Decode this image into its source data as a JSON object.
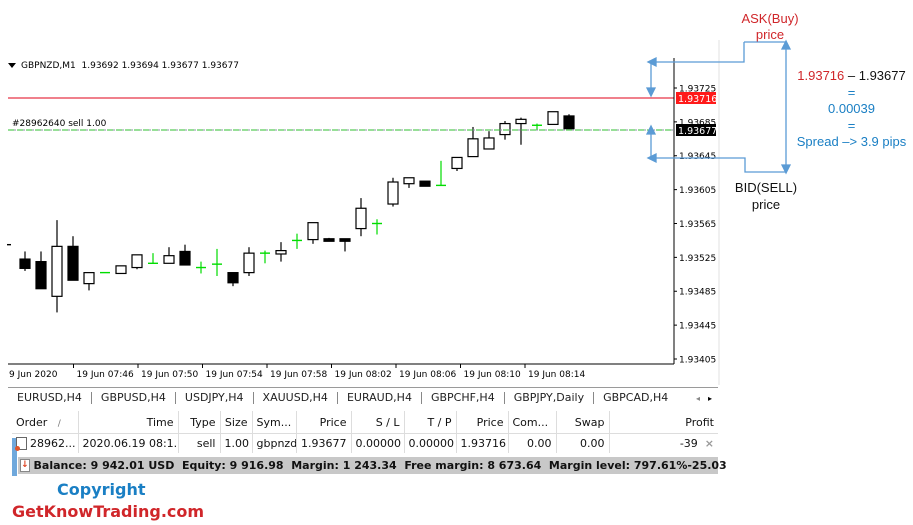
{
  "chart": {
    "header": {
      "symbol": "GBPNZD,M1",
      "ohlc": "1.93692 1.93694 1.93677 1.93677"
    },
    "order_label": "#28962640 sell 1.00",
    "ask_price_label": "1.93716",
    "bid_price_label": "1.93677",
    "colors": {
      "ask_line": "#e0001a",
      "bid_line": "#2fbf2f",
      "ask_badge": "#ff1a1a",
      "bid_badge": "#000000",
      "doji": "#00dd00"
    }
  },
  "chart_data": {
    "type": "candlestick",
    "title": "GBPNZD,M1",
    "ylim": [
      1.93385,
      1.93745
    ],
    "y_ticks": [
      "1.93725",
      "1.93685",
      "1.93645",
      "1.93605",
      "1.93565",
      "1.93525",
      "1.93485",
      "1.93445",
      "1.93405"
    ],
    "x_ticks": [
      "9 Jun 2020",
      "19 Jun 07:46",
      "19 Jun 07:50",
      "19 Jun 07:54",
      "19 Jun 07:58",
      "19 Jun 08:02",
      "19 Jun 08:06",
      "19 Jun 08:10",
      "19 Jun 08:14"
    ],
    "ask": 1.93716,
    "bid": 1.93677,
    "candles": [
      {
        "o": 1.9354,
        "h": 1.9354,
        "l": 1.9354,
        "c": 1.9354
      },
      {
        "o": 1.93523,
        "h": 1.93532,
        "l": 1.93509,
        "c": 1.93512
      },
      {
        "o": 1.9352,
        "h": 1.93532,
        "l": 1.93488,
        "c": 1.93488
      },
      {
        "o": 1.93479,
        "h": 1.93569,
        "l": 1.9346,
        "c": 1.93538
      },
      {
        "o": 1.93538,
        "h": 1.9355,
        "l": 1.93498,
        "c": 1.93498
      },
      {
        "o": 1.93494,
        "h": 1.93494,
        "l": 1.93486,
        "c": 1.93507
      },
      {
        "o": 1.93507,
        "h": 1.93507,
        "l": 1.93507,
        "c": 1.93507
      },
      {
        "o": 1.93506,
        "h": 1.93515,
        "l": 1.93506,
        "c": 1.93515
      },
      {
        "o": 1.93513,
        "h": 1.93528,
        "l": 1.93511,
        "c": 1.93528
      },
      {
        "o": 1.93518,
        "h": 1.9353,
        "l": 1.93518,
        "c": 1.93518
      },
      {
        "o": 1.93518,
        "h": 1.93537,
        "l": 1.93518,
        "c": 1.93527
      },
      {
        "o": 1.93532,
        "h": 1.9354,
        "l": 1.93516,
        "c": 1.93516
      },
      {
        "o": 1.93513,
        "h": 1.9352,
        "l": 1.93506,
        "c": 1.93513
      },
      {
        "o": 1.93517,
        "h": 1.93535,
        "l": 1.93503,
        "c": 1.93517
      },
      {
        "o": 1.93507,
        "h": 1.93507,
        "l": 1.93491,
        "c": 1.93495
      },
      {
        "o": 1.93507,
        "h": 1.93537,
        "l": 1.93503,
        "c": 1.9353
      },
      {
        "o": 1.9353,
        "h": 1.93533,
        "l": 1.93518,
        "c": 1.9353
      },
      {
        "o": 1.93529,
        "h": 1.93543,
        "l": 1.9352,
        "c": 1.93533
      },
      {
        "o": 1.93545,
        "h": 1.93553,
        "l": 1.93535,
        "c": 1.93545
      },
      {
        "o": 1.93546,
        "h": 1.93566,
        "l": 1.93541,
        "c": 1.93566
      },
      {
        "o": 1.93547,
        "h": 1.93548,
        "l": 1.93545,
        "c": 1.93544
      },
      {
        "o": 1.93547,
        "h": 1.93547,
        "l": 1.93532,
        "c": 1.93544
      },
      {
        "o": 1.93559,
        "h": 1.93595,
        "l": 1.9355,
        "c": 1.93583
      },
      {
        "o": 1.93565,
        "h": 1.9357,
        "l": 1.93552,
        "c": 1.93565
      },
      {
        "o": 1.93588,
        "h": 1.93619,
        "l": 1.93585,
        "c": 1.93614
      },
      {
        "o": 1.93612,
        "h": 1.93618,
        "l": 1.93607,
        "c": 1.93619
      },
      {
        "o": 1.93615,
        "h": 1.93615,
        "l": 1.93615,
        "c": 1.93609
      },
      {
        "o": 1.9361,
        "h": 1.93639,
        "l": 1.9361,
        "c": 1.9361
      },
      {
        "o": 1.9363,
        "h": 1.93643,
        "l": 1.93627,
        "c": 1.93643
      },
      {
        "o": 1.93644,
        "h": 1.93679,
        "l": 1.93644,
        "c": 1.93665
      },
      {
        "o": 1.93653,
        "h": 1.93674,
        "l": 1.93653,
        "c": 1.93666
      },
      {
        "o": 1.9367,
        "h": 1.93686,
        "l": 1.93664,
        "c": 1.93683
      },
      {
        "o": 1.93683,
        "h": 1.9369,
        "l": 1.93658,
        "c": 1.93688
      },
      {
        "o": 1.93681,
        "h": 1.93683,
        "l": 1.93676,
        "c": 1.93681
      },
      {
        "o": 1.93682,
        "h": 1.93697,
        "l": 1.93682,
        "c": 1.93697
      },
      {
        "o": 1.93692,
        "h": 1.93694,
        "l": 1.93677,
        "c": 1.93677
      }
    ]
  },
  "tabs": {
    "items": [
      "EURUSD,H4",
      "GBPUSD,H4",
      "USDJPY,H4",
      "XAUUSD,H4",
      "EURAUD,H4",
      "GBPCHF,H4",
      "GBPJPY,Daily",
      "GBPCAD,H4"
    ],
    "prev": "◂",
    "next": "▸"
  },
  "terminal": {
    "columns": [
      "Order",
      "Time",
      "Type",
      "Size",
      "Sym...",
      "Price",
      "S / L",
      "T / P",
      "Price",
      "Com...",
      "Swap",
      "Profit"
    ],
    "sort_indicator": "/",
    "rows": [
      {
        "order": "28962...",
        "time": "2020.06.19 08:1...",
        "type": "sell",
        "size": "1.00",
        "symbol": "gbpnzd",
        "price": "1.93677",
        "sl": "0.00000",
        "tp": "0.00000",
        "cur_price": "1.93716",
        "commission": "0.00",
        "swap": "0.00",
        "profit": "-39",
        "close": "×"
      }
    ],
    "summary": "Balance: 9 942.01 USD  Equity: 9 916.98  Margin: 1 243.34  Free margin: 8 673.64  Margin level: 797.61%",
    "summary_profit": "-25.03"
  },
  "annotations": {
    "ask_title": "ASK(Buy)",
    "ask_sub": "price",
    "bid_title": "BID(SELL)",
    "bid_sub": "price",
    "formula_ask": "1.93716",
    "formula_dash": " – ",
    "formula_bid": "1.93677",
    "eq1": "=",
    "diff": "0.00039",
    "eq2": "=",
    "spread": "Spread –> 3.9 pips",
    "colors": {
      "red": "#d0262a",
      "blue": "#1a7fc4",
      "arrow": "#5b9bd5"
    }
  },
  "footer": {
    "copyright": "Copyright",
    "site": "GetKnowTrading.com"
  }
}
